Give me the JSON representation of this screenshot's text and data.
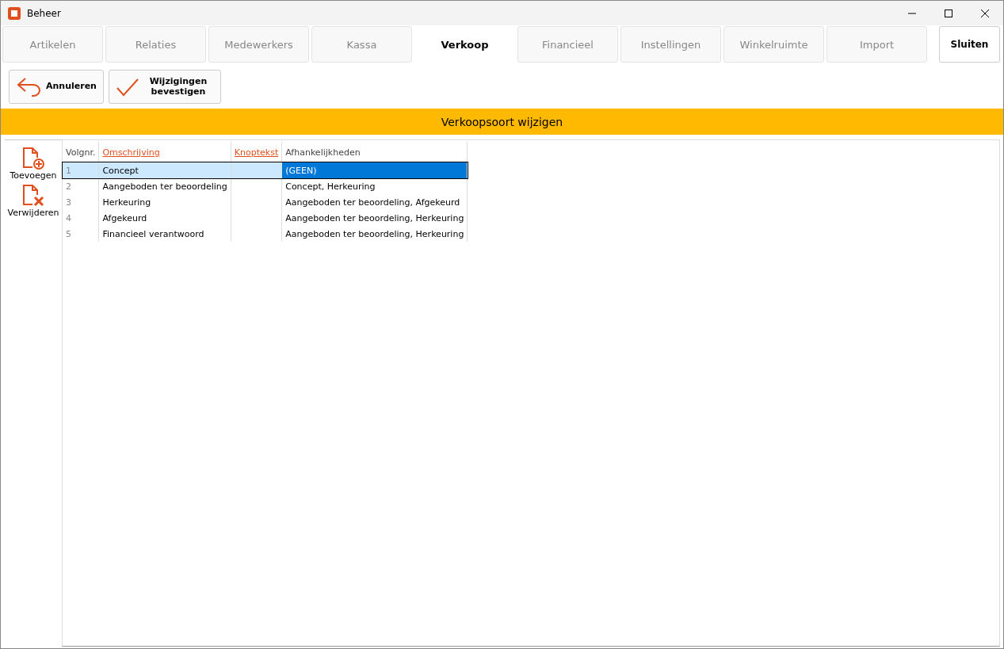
{
  "window": {
    "title": "Beheer"
  },
  "tabs": [
    {
      "label": "Artikelen",
      "selected": false
    },
    {
      "label": "Relaties",
      "selected": false
    },
    {
      "label": "Medewerkers",
      "selected": false
    },
    {
      "label": "Kassa",
      "selected": false
    },
    {
      "label": "Verkoop",
      "selected": true
    },
    {
      "label": "Financieel",
      "selected": false
    },
    {
      "label": "Instellingen",
      "selected": false
    },
    {
      "label": "Winkelruimte",
      "selected": false
    },
    {
      "label": "Import",
      "selected": false
    }
  ],
  "close_button": "Sluiten",
  "toolbar": [
    {
      "kind": "undo",
      "label": "Annuleren"
    },
    {
      "kind": "check",
      "label": "Wijzigingen bevestigen"
    }
  ],
  "banner": "Verkoopsoort wijzigen",
  "side_actions": [
    {
      "kind": "add",
      "label": "Toevoegen"
    },
    {
      "kind": "remove",
      "label": "Verwijderen"
    }
  ],
  "table": {
    "columns": [
      {
        "label": "Volgnr.",
        "kind": "plain"
      },
      {
        "label": "Omschrijving",
        "kind": "link"
      },
      {
        "label": "Knoptekst",
        "kind": "link"
      },
      {
        "label": "Afhankelijkheden",
        "kind": "plain"
      }
    ],
    "rows": [
      {
        "selected": true,
        "cells": [
          "1",
          "Concept",
          "",
          "(GEEN)"
        ]
      },
      {
        "selected": false,
        "cells": [
          "2",
          "Aangeboden ter beoordeling",
          "",
          "Concept, Herkeuring"
        ]
      },
      {
        "selected": false,
        "cells": [
          "3",
          "Herkeuring",
          "",
          "Aangeboden ter beoordeling, Afgekeurd"
        ]
      },
      {
        "selected": false,
        "cells": [
          "4",
          "Afgekeurd",
          "",
          "Aangeboden ter beoordeling, Herkeuring"
        ]
      },
      {
        "selected": false,
        "cells": [
          "5",
          "Financieel verantwoord",
          "",
          "Aangeboden ter beoordeling, Herkeuring"
        ]
      }
    ]
  }
}
